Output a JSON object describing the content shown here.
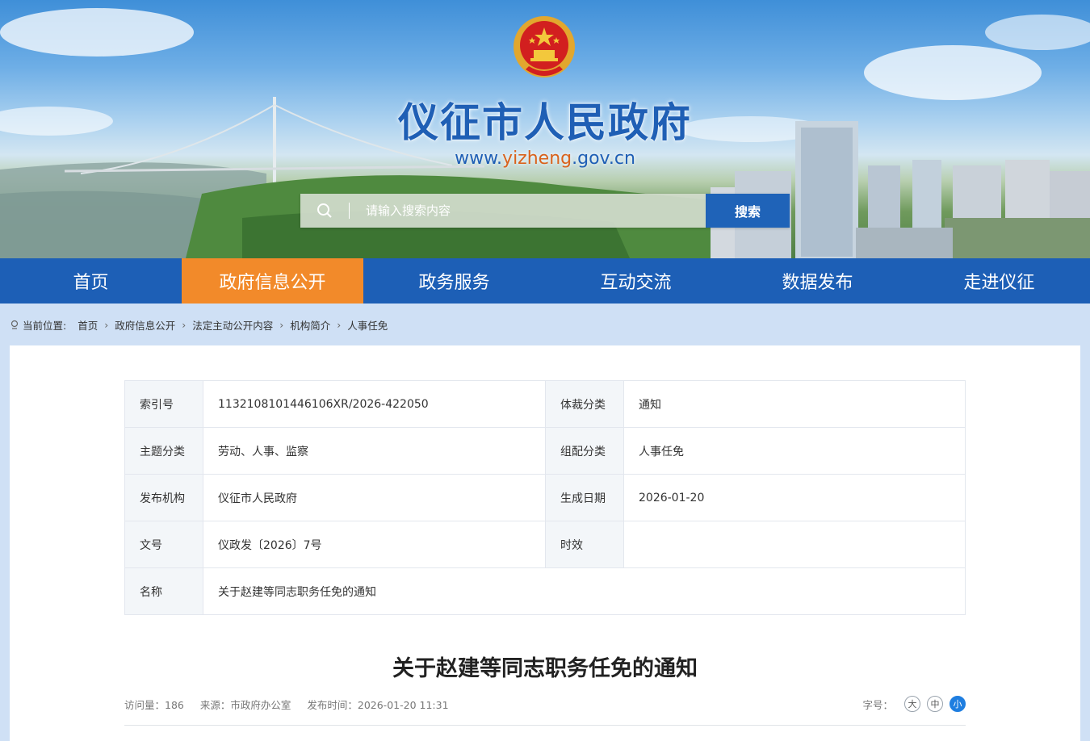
{
  "header": {
    "site_title": "仪征市人民政府",
    "url_prefix": "www.",
    "url_highlight": "yizheng",
    "url_suffix": ".gov.cn",
    "search_placeholder": "请输入搜索内容",
    "search_button": "搜索"
  },
  "nav": {
    "items": [
      {
        "label": "首页"
      },
      {
        "label": "政府信息公开",
        "active": true
      },
      {
        "label": "政务服务"
      },
      {
        "label": "互动交流"
      },
      {
        "label": "数据发布"
      },
      {
        "label": "走进仪征"
      }
    ]
  },
  "breadcrumb": {
    "label": "当前位置:",
    "items": [
      "首页",
      "政府信息公开",
      "法定主动公开内容",
      "机构简介",
      "人事任免"
    ]
  },
  "meta": {
    "rows": [
      {
        "k1": "索引号",
        "v1": "1132108101446106XR/2026-422050",
        "k2": "体裁分类",
        "v2": "通知"
      },
      {
        "k1": "主题分类",
        "v1": "劳动、人事、监察",
        "k2": "组配分类",
        "v2": "人事任免"
      },
      {
        "k1": "发布机构",
        "v1": "仪征市人民政府",
        "k2": "生成日期",
        "v2": "2026-01-20"
      },
      {
        "k1": "文号",
        "v1": "仪政发〔2026〕7号",
        "k2": "时效",
        "v2": ""
      },
      {
        "k1": "名称",
        "v1": "关于赵建等同志职务任免的通知"
      }
    ]
  },
  "article": {
    "title": "关于赵建等同志职务任免的通知",
    "views": "访问量：186",
    "source": "来源：市政府办公室",
    "publish_time": "发布时间：2026-01-20 11:31",
    "font_label": "字号：",
    "font_sizes": [
      "大",
      "中",
      "小"
    ],
    "font_active": "小"
  },
  "colors": {
    "primary_blue": "#1d5fb6",
    "active_orange": "#f28a2a",
    "page_bg": "#cfe0f5"
  }
}
